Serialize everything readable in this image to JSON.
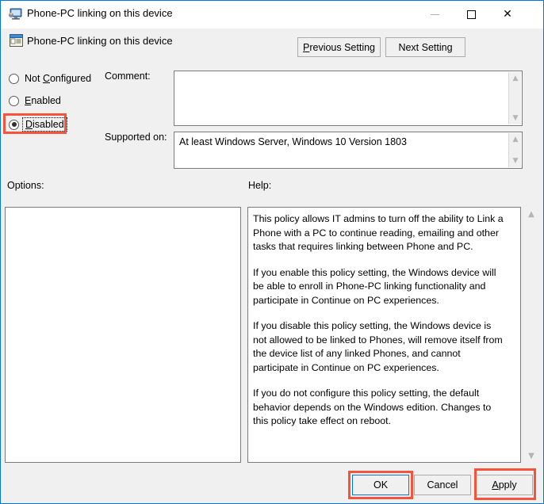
{
  "window": {
    "title": "Phone-PC linking on this device",
    "title_icon": "monitor-icon",
    "controls": {
      "minimize": "minimize-icon",
      "maximize": "maximize-icon",
      "close": "close-icon"
    }
  },
  "header": {
    "icon": "policy-setting-icon",
    "title": "Phone-PC linking on this device",
    "previous_button": "Previous Setting",
    "previous_accel": "P",
    "next_button": "Next Setting"
  },
  "state_options": [
    {
      "label": "Not Configured",
      "accel": "C",
      "selected": false
    },
    {
      "label": "Enabled",
      "accel": "E",
      "selected": false
    },
    {
      "label": "Disabled",
      "accel": "D",
      "selected": true,
      "highlighted": true,
      "focused": true
    }
  ],
  "comment": {
    "label": "Comment:",
    "value": "",
    "placeholder": ""
  },
  "supported": {
    "label": "Supported on:",
    "value": "At least Windows Server, Windows 10 Version 1803"
  },
  "options": {
    "label": "Options:",
    "value": ""
  },
  "help": {
    "label": "Help:",
    "paragraphs": [
      "This policy allows IT admins to turn off the ability to Link a Phone with a PC to continue reading, emailing and other tasks that requires linking between Phone and PC.",
      "If you enable this policy setting, the Windows device will be able to enroll in Phone-PC linking functionality and participate in Continue on PC experiences.",
      "If you disable this policy setting, the Windows device is not allowed to be linked to Phones, will remove itself from the device list of any linked Phones, and cannot participate in Continue on PC experiences.",
      "If you do not configure this policy setting, the default behavior depends on the Windows edition. Changes to this policy take effect on reboot."
    ]
  },
  "footer": {
    "ok": "OK",
    "cancel": "Cancel",
    "apply": "Apply",
    "apply_accel": "A",
    "ok_highlighted": true,
    "apply_highlighted": true,
    "ok_focused": true
  },
  "icons": {
    "scroll_up": "▲",
    "scroll_down": "▼"
  },
  "colors": {
    "accent": "#0078d7",
    "annotation": "#f4543c",
    "dialog_bg": "#f0f0f0"
  }
}
